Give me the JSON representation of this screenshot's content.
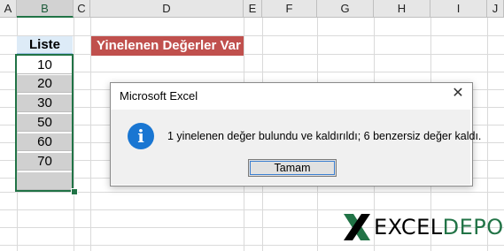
{
  "columns": [
    "A",
    "B",
    "C",
    "D",
    "E",
    "F",
    "G",
    "H",
    "I",
    "J"
  ],
  "selected_column": "B",
  "list": {
    "header": "Liste",
    "values": [
      "10",
      "20",
      "30",
      "50",
      "60",
      "70",
      ""
    ]
  },
  "banner": "Yinelenen Değerler Var",
  "dialog": {
    "title": "Microsoft Excel",
    "close_glyph": "✕",
    "icon_glyph": "i",
    "message": "1 yinelenen değer bulundu ve kaldırıldı; 6 benzersiz değer kaldı.",
    "ok_label": "Tamam"
  },
  "logo": {
    "part1": "EXCEL",
    "part2": "DEPO"
  },
  "colors": {
    "selection": "#217346",
    "banner": "#c0504d",
    "info_icon": "#1976d2"
  }
}
